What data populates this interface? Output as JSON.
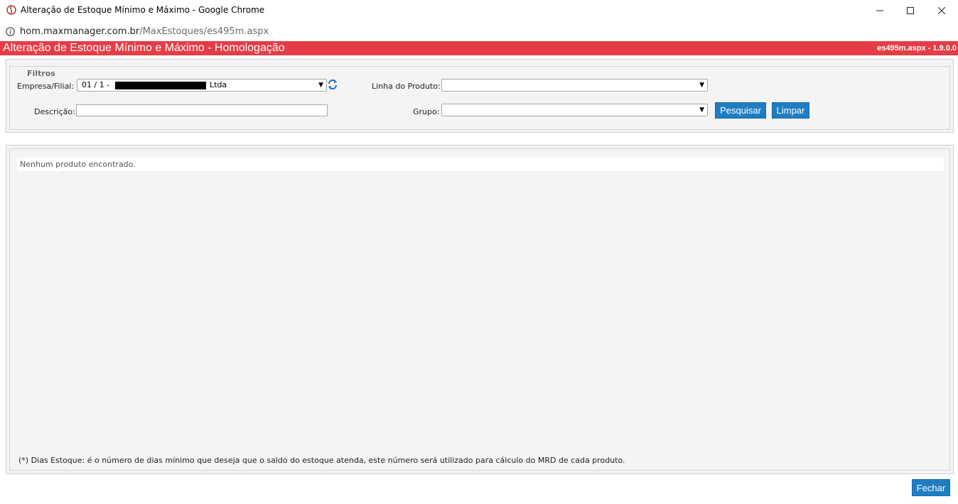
{
  "window": {
    "title": "Alteração de Estoque Mínimo e Máximo - Google Chrome",
    "minimize_icon": "minimize-icon",
    "maximize_icon": "maximize-icon",
    "close_icon": "close-icon"
  },
  "address": {
    "host": "hom.maxmanager.com.br",
    "path": "/MaxEstoques/es495m.aspx"
  },
  "header": {
    "title": "Alteração de Estoque Mínimo e Máximo - Homologação",
    "version": "es495m.aspx - 1.9.0.0",
    "color": "#e43d46"
  },
  "filters": {
    "legend": "Filtros",
    "empresa_label": "Empresa/Filial:",
    "empresa_prefix": "01 / 1 -",
    "empresa_suffix": "Ltda",
    "linha_label": "Linha do Produto:",
    "linha_value": "",
    "descricao_label": "Descrição:",
    "descricao_value": "",
    "grupo_label": "Grupo:",
    "grupo_value": "",
    "search_label": "Pesquisar",
    "clear_label": "Limpar"
  },
  "results": {
    "empty_message": "Nenhum produto encontrado.",
    "note": "(*) Dias Estoque: é o número de dias mínimo que deseja que o saldo do estoque atenda, este número será utilizado para cálculo do MRD de cada produto."
  },
  "footer": {
    "close_label": "Fechar"
  },
  "colors": {
    "button": "#1f7ec2",
    "panel": "#f4f4f4"
  }
}
